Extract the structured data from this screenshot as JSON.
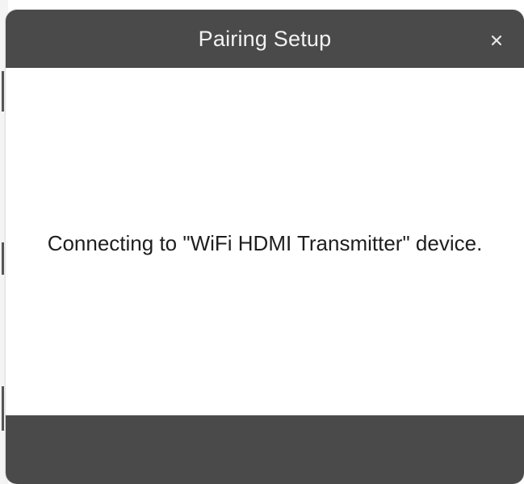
{
  "dialog": {
    "title": "Pairing Setup",
    "close_icon": "close-icon",
    "message": "Connecting to \"WiFi HDMI Transmitter\" device."
  },
  "colors": {
    "header_bg": "#4a4a4a",
    "footer_bg": "#4a4a4a",
    "title_text": "#f2f2f2",
    "body_bg": "#ffffff",
    "message_text": "#1e1e1e"
  }
}
